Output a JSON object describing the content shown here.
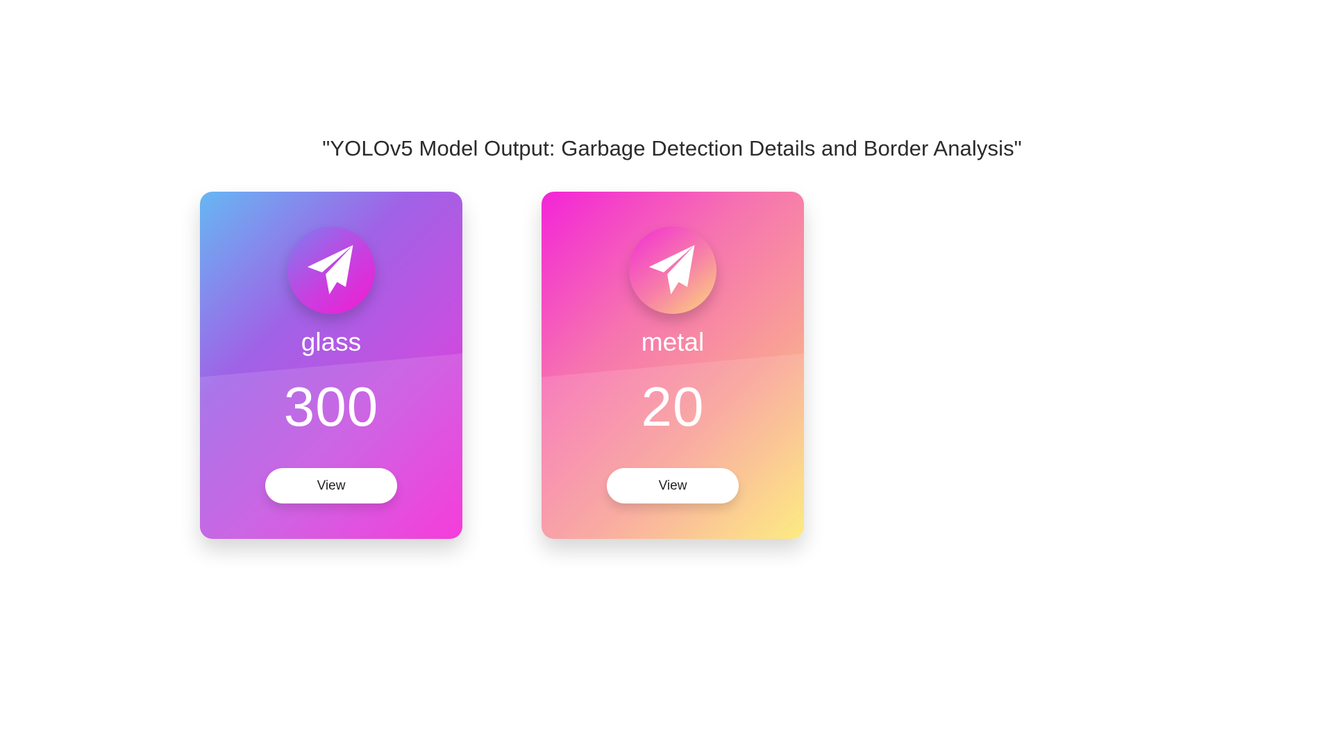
{
  "page": {
    "title": "\"YOLOv5 Model Output: Garbage Detection Details and Border Analysis\""
  },
  "cards": [
    {
      "label": "glass",
      "value": "300",
      "icon": "paper-plane-icon",
      "button_label": "View",
      "gradient_colors": [
        "#66b7f3",
        "#a062e6",
        "#c84fe0",
        "#f522d5"
      ]
    },
    {
      "label": "metal",
      "value": "20",
      "icon": "paper-plane-icon",
      "button_label": "View",
      "gradient_colors": [
        "#f324d8",
        "#f673b0",
        "#f9a096",
        "#fde972"
      ]
    }
  ]
}
